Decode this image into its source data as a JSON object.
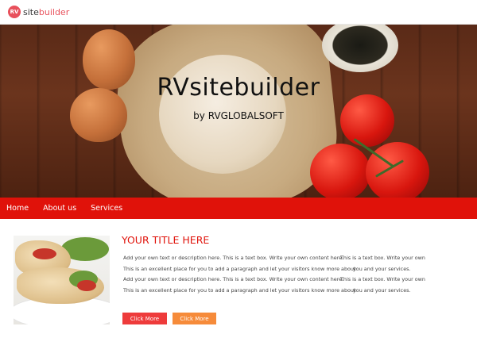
{
  "header": {
    "logo_badge": "RV",
    "logo_part1": "site",
    "logo_part2": "builder"
  },
  "hero": {
    "title": "RVsitebuilder",
    "subtitle": "by RVGLOBALSOFT"
  },
  "nav": {
    "items": [
      "Home",
      "About us",
      "Services"
    ]
  },
  "content": {
    "title": "YOUR TITLE HERE",
    "col1": [
      "Add your own text or description here. This is a text box. Write your own content here.",
      "This is an excellent place for you to add a paragraph and  let your visitors know more about",
      "Add your own text or description here. This is a text box. Write your own content here.",
      "This is an excellent place for you to add a paragraph and  let your visitors know more about"
    ],
    "col2": [
      "This is a text box. Write your own",
      "you and your services.",
      "This is a text box. Write your own",
      "you and your services."
    ],
    "buttons": [
      "Click More",
      "Click More"
    ]
  },
  "colors": {
    "accent": "#e0120a",
    "button1": "#ee3b3b",
    "button2": "#f68b3a",
    "logo": "#e8505b"
  }
}
